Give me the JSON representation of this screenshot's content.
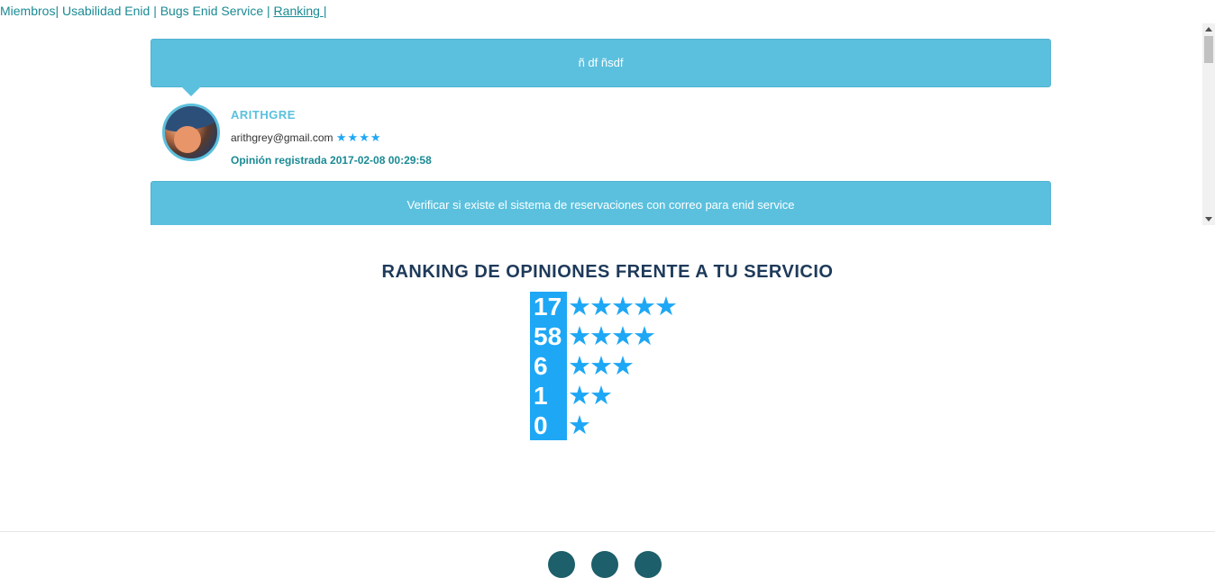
{
  "nav": {
    "items": [
      {
        "label": "Miembros"
      },
      {
        "label": "Usabilidad Enid"
      },
      {
        "label": "Bugs Enid Service"
      },
      {
        "label": "Ranking "
      }
    ],
    "separator": "|"
  },
  "opinions": [
    {
      "text": "ñ df ñsdf",
      "user": "ARITHGRE",
      "email": "arithgrey@gmail.com",
      "stars": "★★★★",
      "date": "Opinión registrada 2017-02-08 00:29:58"
    },
    {
      "text": "Verificar si existe el sistema de reservaciones con correo para enid service"
    }
  ],
  "ranking": {
    "title": "RANKING DE OPINIONES FRENTE A TU SERVICIO",
    "rows": [
      {
        "count": "17",
        "stars": "★★★★★"
      },
      {
        "count": "58",
        "stars": "★★★★"
      },
      {
        "count": "6",
        "stars": "★★★"
      },
      {
        "count": "1",
        "stars": "★★"
      },
      {
        "count": "0",
        "stars": "★"
      }
    ]
  },
  "colors": {
    "accent": "#5bc0de",
    "star": "#1ea7f5",
    "nav": "#1a8a94",
    "title": "#1e3a5a"
  }
}
